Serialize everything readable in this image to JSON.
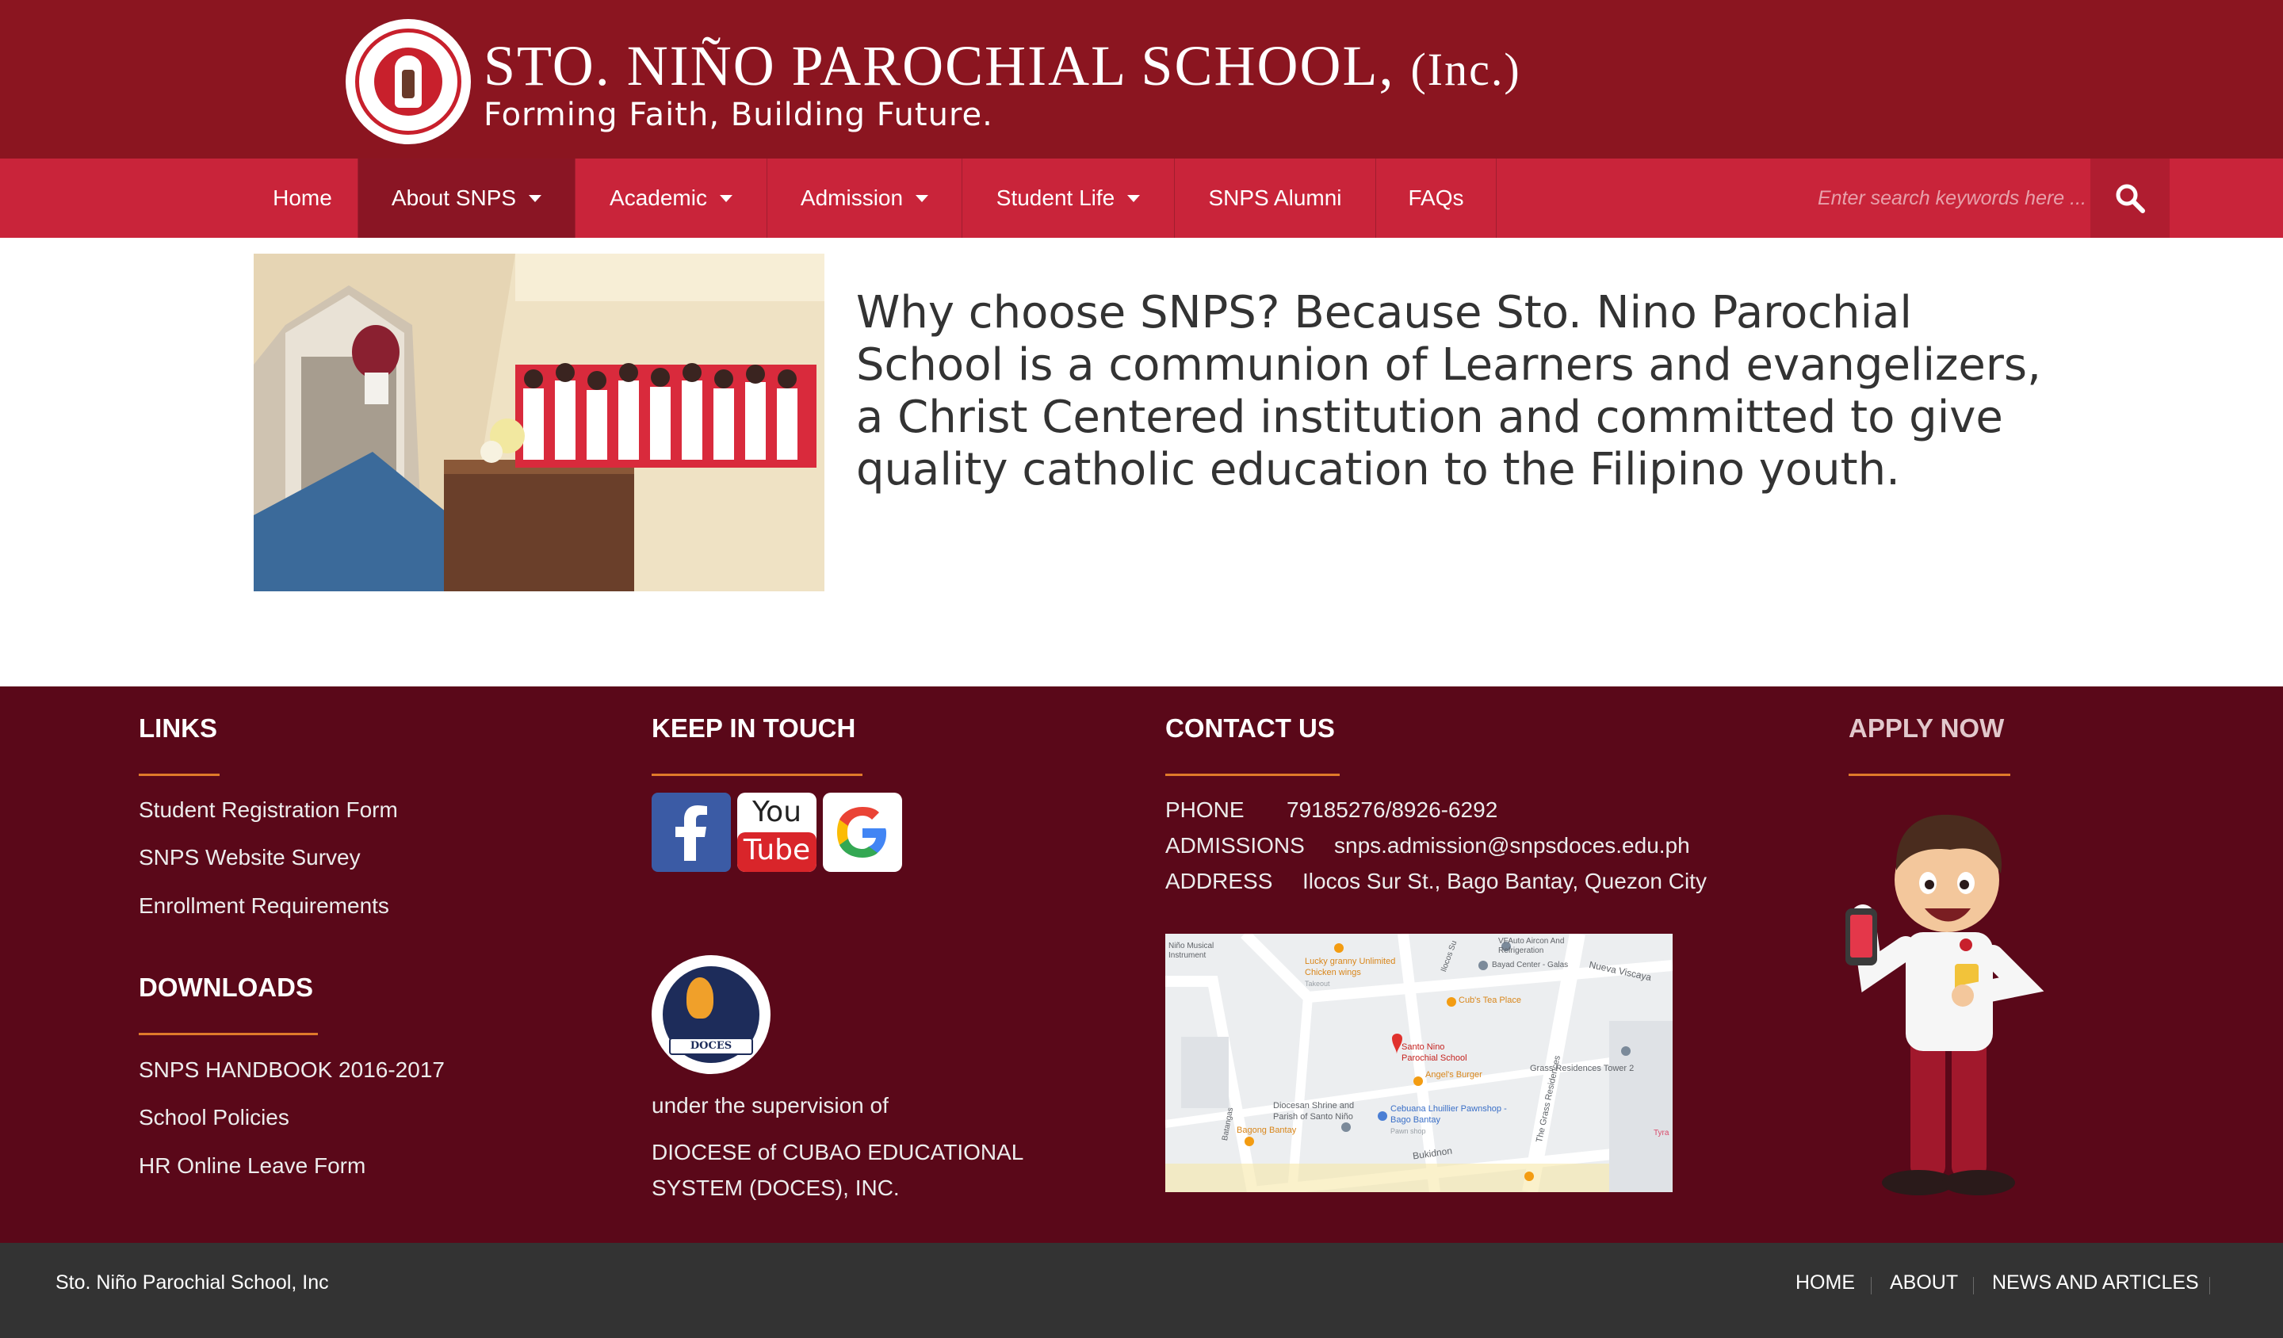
{
  "header": {
    "title": "STO. NIÑO PAROCHIAL SCHOOL,",
    "title_suffix": "(Inc.)",
    "tagline": "Forming Faith, Building Future."
  },
  "nav": {
    "items": [
      {
        "label": "Home",
        "dropdown": false
      },
      {
        "label": "About SNPS",
        "dropdown": true,
        "active": true
      },
      {
        "label": "Academic",
        "dropdown": true
      },
      {
        "label": "Admission",
        "dropdown": true
      },
      {
        "label": "Student Life",
        "dropdown": true
      },
      {
        "label": "SNPS Alumni",
        "dropdown": false
      },
      {
        "label": "FAQs",
        "dropdown": false
      }
    ],
    "search_placeholder": "Enter search keywords here ...",
    "search_icon": "search-icon"
  },
  "main": {
    "intro_text": "Why choose SNPS? Because Sto. Nino Parochial School is a communion of Learners and evangelizers, a Christ Centered institution and committed to give quality catholic education to the Filipino youth."
  },
  "footer": {
    "links": {
      "heading": "LINKS",
      "items": [
        "Student Registration Form",
        "SNPS Website Survey",
        "Enrollment Requirements"
      ]
    },
    "downloads": {
      "heading": "DOWNLOADS",
      "items": [
        "SNPS HANDBOOK 2016-2017",
        "School Policies",
        "HR Online Leave Form"
      ]
    },
    "keep_in_touch": {
      "heading": "KEEP IN TOUCH",
      "social": [
        "facebook-icon",
        "youtube-icon",
        "google-icon"
      ],
      "youtube_top": "You",
      "youtube_bottom": "Tube",
      "doces_badge": "DOCES",
      "supervision_label": "under the supervision of",
      "supervision_line1": "DIOCESE of CUBAO EDUCATIONAL",
      "supervision_line2": "SYSTEM (DOCES), INC."
    },
    "contact": {
      "heading": "CONTACT US",
      "phone_label": "PHONE",
      "phone_value": "79185276/8926-6292",
      "admissions_label": "ADMISSIONS",
      "admissions_value": "snps.admission@snpsdoces.edu.ph",
      "address_label": "ADDRESS",
      "address_value": "Ilocos Sur St., Bago Bantay, Quezon City",
      "map_labels": {
        "school": "Santo Nino Parochial School",
        "chicken": "Lucky granny Unlimited Chicken wings",
        "tea": "Cub's Tea Place",
        "burger": "Angel's Burger",
        "shrine": "Diocesan Shrine and Parish of Santo Niño",
        "pawn": "Cebuana Lhuillier Pawnshop - Bago Bantay",
        "bagong": "Bagong Bantay",
        "grass": "Grass Residences Tower 2",
        "visc": "Nueva Viscaya",
        "bukid": "Bukidnon",
        "vf": "VFAuto Aircon And Refrigeration",
        "bayad": "Bayad Center - Galas",
        "musical": "Niño Musical Instrument",
        "tyra": "Tyra",
        "grass_road": "The Grass Residences",
        "batangas": "Batangas",
        "ilocos": "Ilocos Su",
        "takeout": "Takeout",
        "pawn_shop": "Pawn shop"
      }
    },
    "apply": {
      "heading": "APPLY NOW"
    }
  },
  "bottom_bar": {
    "copyright": "Sto. Niño Parochial School, Inc",
    "links": [
      "HOME",
      "ABOUT",
      "NEWS AND ARTICLES"
    ]
  },
  "colors": {
    "header_bg": "#8b1520",
    "nav_bg": "#c9243a",
    "nav_active": "#8a1524",
    "footer_bg": "#5a0819",
    "accent_rule": "#e07a2a",
    "bottom_bg": "#333333"
  }
}
